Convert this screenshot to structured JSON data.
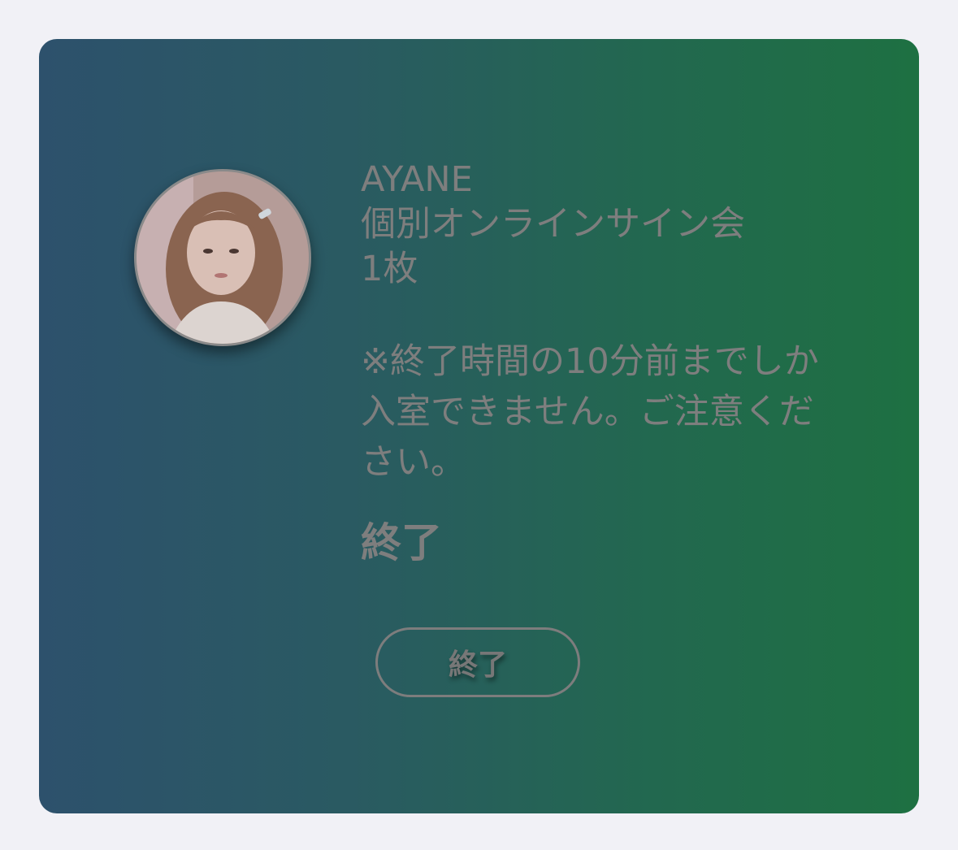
{
  "event": {
    "artist": "AYANE",
    "title": "個別オンラインサイン会",
    "quantity": "1枚",
    "notice": "※終了時間の10分前までしか入室できません。ご注意ください。",
    "status": "終了",
    "button_label": "終了"
  },
  "avatar": {
    "icon": "artist-avatar-photo"
  },
  "colors": {
    "page_background": "#f1f1f6",
    "card_gradient_start": "#2d516c",
    "card_gradient_end": "#1e7042",
    "text": "#7e7e7e"
  }
}
